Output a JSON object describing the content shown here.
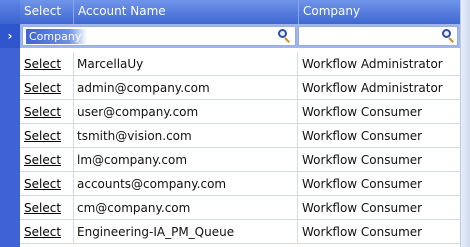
{
  "header": {
    "select": "Select",
    "account_name": "Account Name",
    "company": "Company"
  },
  "filter": {
    "arrow": "›",
    "company_placeholder": "Company"
  },
  "rows": [
    {
      "select": "Select",
      "account": "MarcellaUy",
      "company": "Workflow Administrator"
    },
    {
      "select": "Select",
      "account": "admin@company.com",
      "company": "Workflow Administrator"
    },
    {
      "select": "Select",
      "account": "user@company.com",
      "company": "Workflow Consumer"
    },
    {
      "select": "Select",
      "account": "tsmith@vision.com",
      "company": "Workflow Consumer"
    },
    {
      "select": "Select",
      "account": "lm@company.com",
      "company": "Workflow Consumer"
    },
    {
      "select": "Select",
      "account": "accounts@company.com",
      "company": "Workflow Consumer"
    },
    {
      "select": "Select",
      "account": "cm@company.com",
      "company": "Workflow Consumer"
    },
    {
      "select": "Select",
      "account": "Engineering-IA_PM_Queue",
      "company": "Workflow Consumer"
    }
  ],
  "colors": {
    "header": "#4a72d8",
    "gutter": "#3f62d6",
    "row_border": "#d2dbee"
  },
  "icons": {
    "filter_search": "magnifier-icon",
    "row_indicator": "chevron-right-icon"
  }
}
